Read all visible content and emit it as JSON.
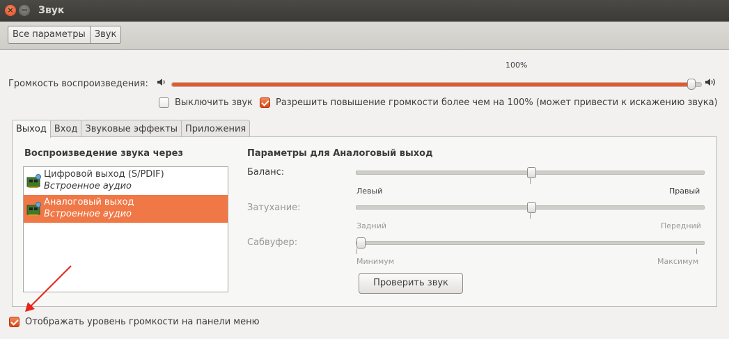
{
  "window": {
    "title": "Звук"
  },
  "toolbar": {
    "crumbs": [
      "Все параметры",
      "Звук"
    ]
  },
  "volume": {
    "label": "Громкость воспроизведения:",
    "percent_text": "100%",
    "level": 0.98,
    "icons": [
      "speaker-low-icon",
      "speaker-high-icon"
    ]
  },
  "options": {
    "mute_label": "Выключить звук",
    "mute_checked": false,
    "overamplify_label": "Разрешить повышение громкости более чем на 100% (может привести к искажению звука)",
    "overamplify_checked": true
  },
  "tabs": [
    "Выход",
    "Вход",
    "Звуковые эффекты",
    "Приложения"
  ],
  "active_tab": "Выход",
  "output": {
    "list_title": "Воспроизведение звука через",
    "devices": [
      {
        "name": "Цифровой выход (S/PDIF)",
        "sub": "Встроенное аудио",
        "selected": false
      },
      {
        "name": "Аналоговый выход",
        "sub": "Встроенное аудио",
        "selected": true
      }
    ],
    "params_title": "Параметры для Аналоговый выход",
    "balance": {
      "label": "Баланс:",
      "left": "Левый",
      "right": "Правый",
      "value": 0.5
    },
    "fade": {
      "label": "Затухание:",
      "left": "Задний",
      "right": "Передний",
      "value": 0.5
    },
    "subwoofer": {
      "label": "Сабвуфер:",
      "left": "Минимум",
      "right": "Максимум",
      "value": 0.0
    },
    "test_button": "Проверить звук"
  },
  "footer": {
    "show_volume_label": "Отображать уровень громкости на панели меню",
    "show_volume_checked": true
  },
  "colors": {
    "accent": "#f07746",
    "titlebar": "#3f3e3a"
  }
}
